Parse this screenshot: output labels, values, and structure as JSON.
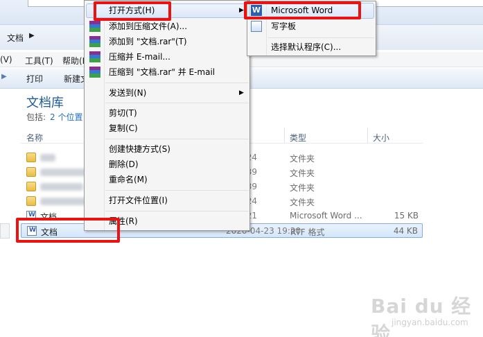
{
  "explorer": {
    "breadcrumb": "文档",
    "menubar": [
      "(V)",
      "工具(T)",
      "帮助(H)"
    ],
    "toolbar": [
      "打印",
      "新建文"
    ],
    "library": {
      "title": "文档库",
      "include_label": "包括:",
      "include_link": "2 个位置"
    },
    "columns": {
      "name": "名称",
      "type": "类型",
      "size": "大小"
    },
    "rows": [
      {
        "name": "",
        "date": "3 16:24",
        "type": "文件夹",
        "size": "",
        "kind": "folder"
      },
      {
        "name": "",
        "date": "3 18:39",
        "type": "文件夹",
        "size": "",
        "kind": "folder"
      },
      {
        "name": "",
        "date": "3 18:39",
        "type": "文件夹",
        "size": "",
        "kind": "folder"
      },
      {
        "name": "",
        "date": "3 16:24",
        "type": "文件夹",
        "size": "",
        "kind": "folder"
      },
      {
        "name": "文档",
        "date": "3 19:21",
        "type": "Microsoft Word ...",
        "size": "15 KB",
        "kind": "doc"
      },
      {
        "name": "文档",
        "date": "2020-04-23 19:20",
        "type": "RTF 格式",
        "size": "44 KB",
        "kind": "doc"
      }
    ]
  },
  "context_menu": {
    "items": [
      {
        "label": "打开方式(H)",
        "submenu": true
      },
      {
        "label": "添加到压缩文件(A)...",
        "icon": "winrar-icon"
      },
      {
        "label": "添加到 \"文档.rar\"(T)",
        "icon": "winrar-icon"
      },
      {
        "label": "压缩并 E-mail...",
        "icon": "winrar-icon"
      },
      {
        "label": "压缩到 \"文档.rar\" 并 E-mail",
        "icon": "winrar-icon"
      },
      {
        "label": "发送到(N)",
        "submenu": true
      },
      {
        "label": "剪切(T)"
      },
      {
        "label": "复制(C)"
      },
      {
        "label": "创建快捷方式(S)"
      },
      {
        "label": "删除(D)"
      },
      {
        "label": "重命名(M)"
      },
      {
        "label": "打开文件位置(I)"
      },
      {
        "label": "属性(R)"
      }
    ]
  },
  "open_with_submenu": {
    "items": [
      {
        "label": "Microsoft Word",
        "icon": "word-icon",
        "highlighted": true
      },
      {
        "label": "写字板",
        "icon": "wordpad-icon"
      },
      {
        "label": "选择默认程序(C)..."
      }
    ]
  },
  "watermark": {
    "main": "Bai du 经验",
    "sub": "jingyan.baidu.com"
  },
  "colors": {
    "highlight_box": "#ee1111",
    "menu_hover": "#dce8f7",
    "library_title": "#1e5a9a"
  }
}
